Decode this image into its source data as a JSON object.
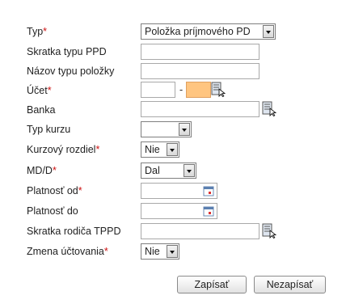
{
  "form": {
    "typ_label": "Typ",
    "typ_value": "Položka príjmového PD",
    "skratka_label": "Skratka typu PPD",
    "nazov_label": "Názov typu položky",
    "ucet_label": "Účet",
    "ucet_separator": "-",
    "banka_label": "Banka",
    "typ_kurzu_label": "Typ kurzu",
    "kurzovy_label": "Kurzový rozdiel",
    "kurzovy_value": "Nie",
    "mdd_label": "MD/D",
    "mdd_value": "Dal",
    "platnost_od_label": "Platnosť od",
    "platnost_do_label": "Platnosť do",
    "skratka_rodica_label": "Skratka rodiča TPPD",
    "zmena_label": "Zmena účtovania",
    "zmena_value": "Nie",
    "required_mark": "*"
  },
  "buttons": {
    "save": "Zapísať",
    "cancel": "Nezapísať"
  },
  "colors": {
    "required": "#cc1111",
    "highlight_field": "#ffc580"
  }
}
